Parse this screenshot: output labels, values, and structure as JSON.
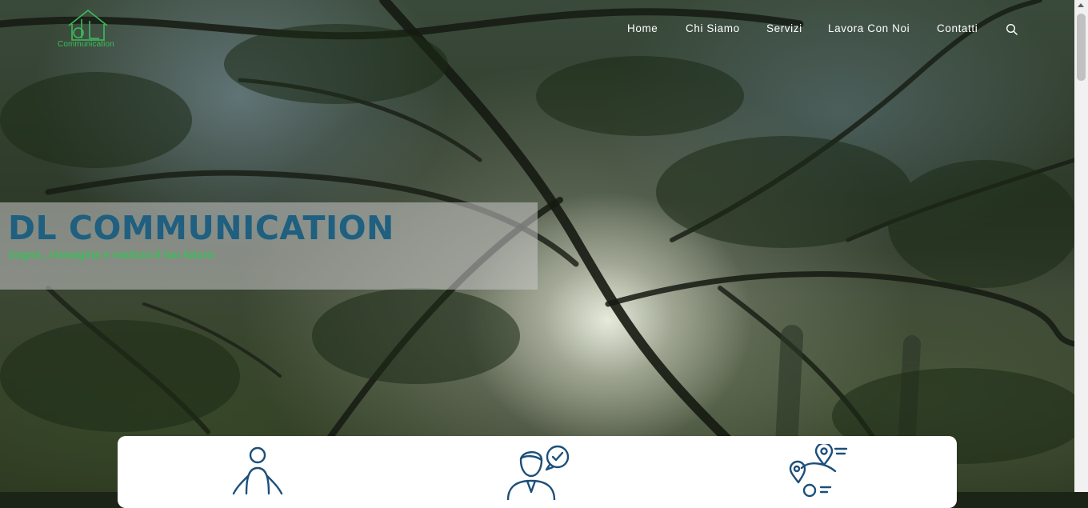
{
  "header": {
    "logo_text": "Communication",
    "nav": [
      {
        "label": "Home"
      },
      {
        "label": "Chi Siamo"
      },
      {
        "label": "Servizi"
      },
      {
        "label": "Lavora Con Noi"
      },
      {
        "label": "Contatti"
      }
    ],
    "search_icon": "search-icon"
  },
  "hero": {
    "title": "DL COMMUNICATION",
    "tagline": "Sogna , Immagina e realizza il tuo futuro"
  },
  "services": {
    "icons": [
      "meditation-person-icon",
      "consultant-check-icon",
      "location-pins-icon"
    ]
  },
  "colors": {
    "brand_blue": "#1f5f80",
    "brand_green": "#3dbd5a",
    "service_icon": "#1c4f7a"
  }
}
